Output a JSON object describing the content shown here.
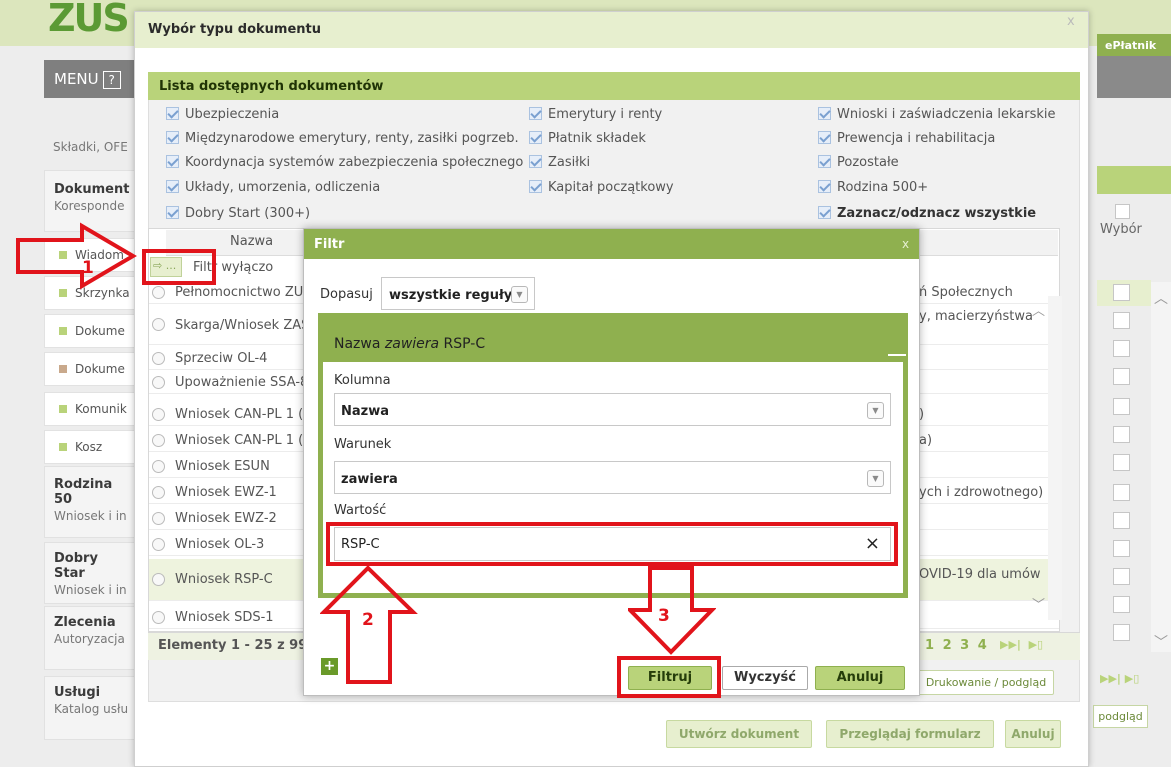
{
  "app": {
    "menu_label": "MENU",
    "menu_help": "?",
    "eplatnik": "ePłatnik"
  },
  "sidebar": {
    "skladki": "Składki, OFE",
    "dokumenty_title": "Dokument",
    "dokumenty_sub": "Koresponde",
    "items": [
      "Wiadom",
      "Skrzynka",
      "Dokume",
      "Dokume",
      "Komunik",
      "Kosz"
    ],
    "rodzina_title": "Rodzina 50",
    "rodzina_sub": "Wniosek i in",
    "dobry_title": "Dobry Star",
    "dobry_sub": "Wniosek i in",
    "zlecenia_title": "Zlecenia",
    "zlecenia_sub": "Autoryzacja",
    "uslugi_title": "Usługi",
    "uslugi_sub": "Katalog usłu"
  },
  "right": {
    "wybor": "Wybór",
    "podglad": "podgląd"
  },
  "doc_dialog": {
    "title": "Wybór typu dokumentu",
    "close": "x",
    "list_header": "Lista dostępnych dokumentów",
    "col1": [
      "Ubezpieczenia",
      "Międzynarodowe emerytury, renty, zasiłki pogrzeb.",
      "Koordynacja systemów zabezpieczenia społecznego",
      "Układy, umorzenia, odliczenia",
      "Dobry Start (300+)"
    ],
    "col2": [
      "Emerytury i renty",
      "Płatnik składek",
      "Zasiłki",
      "Kapitał początkowy"
    ],
    "col3": [
      "Wnioski i zaświadczenia lekarskie",
      "Prewencja i rehabilitacja",
      "Pozostałe",
      "Rodzina 500+"
    ],
    "toggle_all": "Zaznacz/odznacz wszystkie",
    "col_nazwa": "Nazwa",
    "filter_btn": "...",
    "filter_status": "Filtr wyłączo",
    "rows": [
      {
        "name": "Pełnomocnictwo ZU",
        "right": "ń Społecznych"
      },
      {
        "name": "Skarga/Wniosek ZAS",
        "right": "y, macierzyństwa"
      },
      {
        "name": "Sprzeciw OL-4",
        "right": ""
      },
      {
        "name": "Upoważnienie SSA-8",
        "right": ""
      },
      {
        "name": "Wniosek CAN-PL 1 (",
        "right": ")"
      },
      {
        "name": "Wniosek CAN-PL 1 (",
        "right": "a)"
      },
      {
        "name": "Wniosek ESUN",
        "right": ""
      },
      {
        "name": "Wniosek EWZ-1",
        "right": "ych i zdrowotnego)"
      },
      {
        "name": "Wniosek EWZ-2",
        "right": ""
      },
      {
        "name": "Wniosek OL-3",
        "right": ""
      },
      {
        "name": "Wniosek RSP-C",
        "right": "OVID-19 dla umów"
      },
      {
        "name": "Wniosek SDS-1",
        "right": ""
      }
    ],
    "elements": "Elementy 1 - 25 z 99",
    "pages": "1 2 3 4",
    "print_btn": "Drukowanie / podgląd",
    "create_btn": "Utwórz dokument",
    "browse_btn": "Przeglądaj formularz",
    "cancel_btn": "Anuluj"
  },
  "filter": {
    "title": "Filtr",
    "close": "x",
    "match_label": "Dopasuj",
    "match_value": "wszystkie reguły",
    "rule_title_prefix": "Nazwa ",
    "rule_title_op": "zawiera",
    "rule_title_value": " RSP-C",
    "column_label": "Kolumna",
    "column_value": "Nazwa",
    "condition_label": "Warunek",
    "condition_value": "zawiera",
    "value_label": "Wartość",
    "value": "RSP-C",
    "clear_x": "×",
    "add": "+",
    "filter_btn": "Filtruj",
    "clear_btn": "Wyczyść",
    "cancel_btn": "Anuluj"
  },
  "annotations": {
    "n1": "1",
    "n2": "2",
    "n3": "3"
  },
  "colors": {
    "accent": "#8fb04f",
    "header": "#b9d37a",
    "annotation": "#e1141b"
  }
}
